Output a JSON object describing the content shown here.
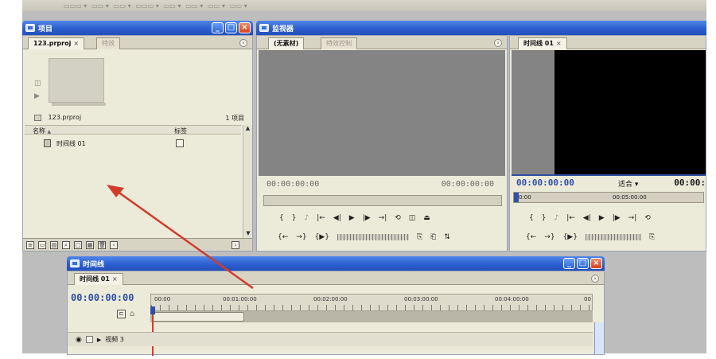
{
  "project_panel": {
    "title": "项目",
    "tabs": [
      {
        "label": "123.prproj",
        "close": "×"
      },
      {
        "label": "特效"
      }
    ],
    "project_file": "123.prproj",
    "item_count": "1 项目",
    "col_name": "名称",
    "col_label": "标签",
    "sort_arrow": "▲",
    "items": [
      {
        "name": "时间线 01"
      }
    ]
  },
  "monitor_panel": {
    "title": "监视器",
    "source_tabs": [
      {
        "label": "(无素材)"
      },
      {
        "label": "特效控制"
      }
    ],
    "source_timecode_left": "00:00:00:00",
    "source_timecode_right": "00:00:00:00",
    "program_tab": {
      "label": "时间线 01",
      "close": "×"
    },
    "program_timecode": "00:00:00:00",
    "fit_label": "适合",
    "fit_arrow": "▾",
    "program_timecode_right": "00:00:",
    "program_ruler_start": "0:00",
    "program_ruler_mark": "00:05:00:00"
  },
  "transport_symbols": {
    "mark_in": "{",
    "mark_out": "}",
    "go_in": "|←",
    "step_back": "◀|",
    "play": "▶",
    "step_fwd": "|▶",
    "go_out": "→|",
    "loop": "⟲",
    "safe": "◫",
    "export": "⏏",
    "shuttle_left": "{←",
    "shuttle_right": "→}",
    "play_in_out": "{▶}"
  },
  "timeline_panel": {
    "title": "时间线",
    "tab": {
      "label": "时间线 01",
      "close": "×"
    },
    "current_time": "00:00:00:00",
    "ruler_labels": [
      "00:00",
      "00:01:00:00",
      "00:02:00:00",
      "00:03:00:00",
      "00:04:00:00",
      "00"
    ],
    "tracks": [
      {
        "name": "视频 3"
      }
    ]
  },
  "window_buttons": {
    "minimize": "_",
    "maximize": "□",
    "close": "×"
  },
  "colors": {
    "xp_title_blue": "#2c5fd0",
    "panel_beige": "#ecead8",
    "monitor_gray": "#848484",
    "program_black": "#000000",
    "annotation_arrow": "#d13b2a",
    "timecode_blue": "#2e4fa8"
  },
  "icons": {
    "panel_icon": "window-icon",
    "annotation": "red-arrow"
  }
}
